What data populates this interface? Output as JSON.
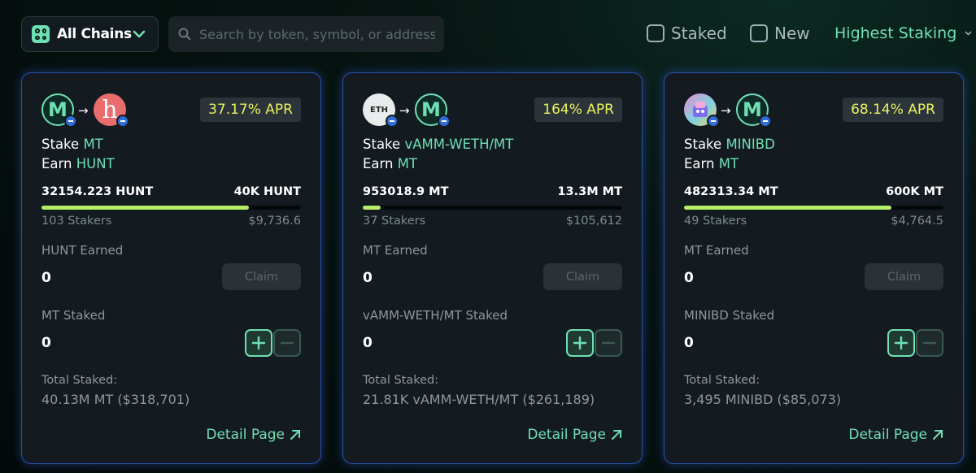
{
  "toolbar": {
    "chain_label": "All Chains",
    "search_placeholder": "Search by token, symbol, or address",
    "filter_staked": "Staked",
    "filter_new": "New",
    "sort_label": "Highest Staking"
  },
  "colors": {
    "accent": "#6fe0b4",
    "apr_text": "#e9f25e",
    "card_border": "#2a4fb0",
    "progress": "#b7ee68"
  },
  "cards": [
    {
      "apr": "37.17% APR",
      "stake_prefix": "Stake",
      "stake_token": "MT",
      "earn_prefix": "Earn",
      "earn_token": "HUNT",
      "amount_left": "32154.223 HUNT",
      "amount_right": "40K HUNT",
      "progress_fraction": 0.8,
      "stakers": "103 Stakers",
      "usd": "$9,736.6",
      "earned_label": "HUNT Earned",
      "earned_value": "0",
      "claim_label": "Claim",
      "staked_label": "MT Staked",
      "staked_value": "0",
      "total_label": "Total Staked:",
      "total_value": "40.13M MT ($318,701)",
      "detail_label": "Detail Page",
      "token_a_icon": "mt-logo",
      "token_b_icon": "hunt-logo"
    },
    {
      "apr": "164% APR",
      "stake_prefix": "Stake",
      "stake_token": "vAMM-WETH/MT",
      "earn_prefix": "Earn",
      "earn_token": "MT",
      "amount_left": "953018.9 MT",
      "amount_right": "13.3M MT",
      "progress_fraction": 0.07,
      "stakers": "37 Stakers",
      "usd": "$105,612",
      "earned_label": "MT Earned",
      "earned_value": "0",
      "claim_label": "Claim",
      "staked_label": "vAMM-WETH/MT Staked",
      "staked_value": "0",
      "total_label": "Total Staked:",
      "total_value": "21.81K vAMM-WETH/MT ($261,189)",
      "detail_label": "Detail Page",
      "token_a_icon": "eth-logo",
      "token_a_text": "ETH",
      "token_b_icon": "mt-logo"
    },
    {
      "apr": "68.14% APR",
      "stake_prefix": "Stake",
      "stake_token": "MINIBD",
      "earn_prefix": "Earn",
      "earn_token": "MT",
      "amount_left": "482313.34 MT",
      "amount_right": "600K MT",
      "progress_fraction": 0.8,
      "stakers": "49 Stakers",
      "usd": "$4,764.5",
      "earned_label": "MT Earned",
      "earned_value": "0",
      "claim_label": "Claim",
      "staked_label": "MINIBD Staked",
      "staked_value": "0",
      "total_label": "Total Staked:",
      "total_value": "3,495 MINIBD ($85,073)",
      "detail_label": "Detail Page",
      "token_a_icon": "minibd-logo",
      "token_b_icon": "mt-logo"
    }
  ]
}
